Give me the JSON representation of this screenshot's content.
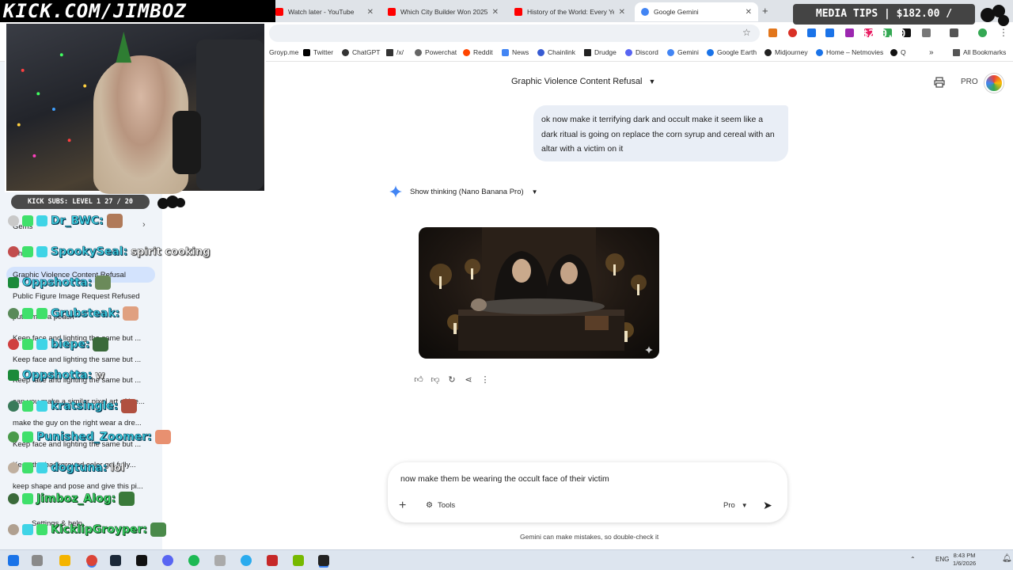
{
  "browser": {
    "tabs": [
      {
        "title": "Watch later - YouTube",
        "color": "#ff0000"
      },
      {
        "title": "Which City Builder Won 2025?",
        "color": "#ff0000"
      },
      {
        "title": "History of the World: Every Yea",
        "color": "#ff0000"
      },
      {
        "title": "Google Gemini",
        "color": "#4285f4"
      }
    ],
    "bookmarks": [
      {
        "label": "Groyp.me",
        "icon": "groyp-icon",
        "color": "#888"
      },
      {
        "label": "Twitter",
        "icon": "x-icon",
        "color": "#000"
      },
      {
        "label": "ChatGPT",
        "icon": "chatgpt-icon",
        "color": "#333"
      },
      {
        "label": "/x/",
        "icon": "grid-icon",
        "color": "#333"
      },
      {
        "label": "Powerchat",
        "icon": "powerchat-icon",
        "color": "#666"
      },
      {
        "label": "Reddit",
        "icon": "reddit-icon",
        "color": "#ff4500"
      },
      {
        "label": "News",
        "icon": "news-icon",
        "color": "#4285f4"
      },
      {
        "label": "Chainlink",
        "icon": "chainlink-icon",
        "color": "#375bd2"
      },
      {
        "label": "Drudge",
        "icon": "drudge-icon",
        "color": "#222"
      },
      {
        "label": "Discord",
        "icon": "discord-icon",
        "color": "#5865f2"
      },
      {
        "label": "Gemini",
        "icon": "gemini-icon",
        "color": "#4285f4"
      },
      {
        "label": "Google Earth",
        "icon": "earth-icon",
        "color": "#1a73e8"
      },
      {
        "label": "Midjourney",
        "icon": "midjourney-icon",
        "color": "#222"
      },
      {
        "label": "Home – Netmovies",
        "icon": "netmovies-icon",
        "color": "#1a73e8"
      },
      {
        "label": "Q",
        "icon": "q-icon",
        "color": "#111"
      }
    ],
    "all_bookmarks": "All Bookmarks"
  },
  "sidebar": {
    "gems_label": "Gems",
    "chats_label": "Chats",
    "items": [
      "Graphic Violence Content Refusal",
      "Public Figure Image Request Refused",
      "put him in a peach",
      "Keep face and lighting the same but ...",
      "Keep face and lighting the same but ...",
      "Keep face and lighting the same but ...",
      "can you make a similar pixel art of ine...",
      "make the guy on the right wear a dre...",
      "Keep face and lighting the same but ...",
      "Keep the background color gel fully...",
      "keep shape and pose and give this pi..."
    ],
    "settings_label": "Settings & help"
  },
  "overlay": {
    "logo_text": "KICK.COM/JIMBOZ",
    "subs_text": "KICK SUBS: LEVEL 1  27 / 20",
    "tips_text": "MEDIA TIPS | $182.00 / $200.00",
    "chat": [
      {
        "name": "Dr_BWC:",
        "msg": "",
        "style": "cyan"
      },
      {
        "name": "SpookySeal:",
        "msg": "spirit cooking",
        "style": "cyan"
      },
      {
        "name": "Oppshotta:",
        "msg": "",
        "style": "cyan"
      },
      {
        "name": "Grubsteak:",
        "msg": "",
        "style": "cyan"
      },
      {
        "name": "biepe:",
        "msg": "",
        "style": "cyan"
      },
      {
        "name": "Oppshotta:",
        "msg": "w",
        "style": "cyan"
      },
      {
        "name": "kratsingle:",
        "msg": "",
        "style": "cyan"
      },
      {
        "name": "Punished_Zoomer:",
        "msg": "",
        "style": "cyan"
      },
      {
        "name": "dogtuna:",
        "msg": "lol",
        "style": "cyan"
      },
      {
        "name": "Jimboz_Alog:",
        "msg": "",
        "style": "green"
      },
      {
        "name": "KicklipGroyper:",
        "msg": "",
        "style": "green"
      }
    ]
  },
  "main": {
    "conversation_title": "Graphic Violence Content Refusal",
    "pro_badge": "PRO",
    "user_prompt": "ok now make it terrifying dark and occult make it seem like a dark ritual is going on replace the corn syrup and cereal with an altar with a victim on it",
    "show_thinking": "Show thinking (Nano Banana Pro)",
    "input_value": "now make them be wearing the occult face of their victim",
    "tools_label": "Tools",
    "model_label": "Pro",
    "disclaimer": "Gemini can make mistakes, so double-check it"
  },
  "taskbar": {
    "lang": "ENG",
    "time": "8:43 PM",
    "date": "1/6/2026"
  }
}
